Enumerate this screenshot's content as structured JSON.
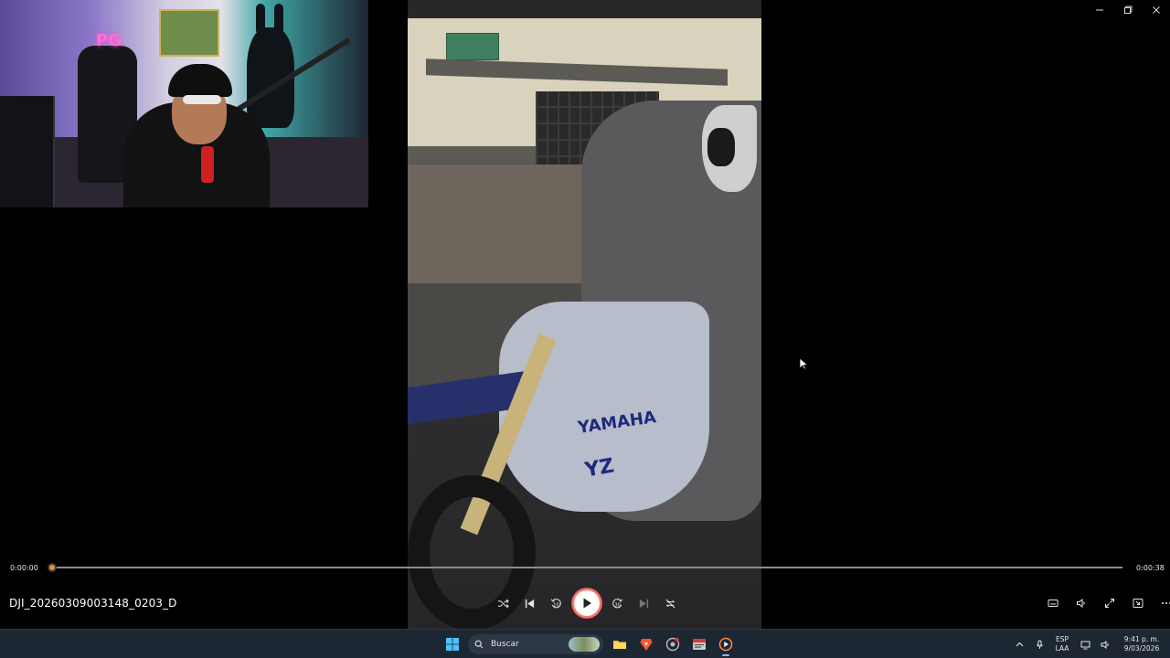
{
  "window": {
    "minimize_icon": "minimize-icon",
    "maximize_icon": "restore-icon",
    "close_icon": "close-icon"
  },
  "video": {
    "bike_brand_text": "YAMAHA",
    "bike_model_text": "YZ"
  },
  "webcam": {
    "neon_sign_text": "PG"
  },
  "player": {
    "current_time": "0:00:00",
    "total_time": "0:00:38",
    "progress": 0,
    "file_name": "DJI_20260309003148_0203_D",
    "colors": {
      "accent": "#e8912f",
      "play_ring": "#ff7a4f",
      "background": "#000000"
    },
    "controls": [
      {
        "name": "shuffle",
        "icon": "shuffle-icon"
      },
      {
        "name": "previous",
        "icon": "skip-previous-icon"
      },
      {
        "name": "rewind-10",
        "icon": "rewind-10-icon",
        "label": "10"
      },
      {
        "name": "play",
        "icon": "play-icon"
      },
      {
        "name": "forward-30",
        "icon": "forward-30-icon",
        "label": "30"
      },
      {
        "name": "next",
        "icon": "skip-next-icon"
      },
      {
        "name": "repeat-off",
        "icon": "repeat-off-icon"
      }
    ],
    "right_controls": [
      {
        "name": "subtitles",
        "icon": "subtitles-icon"
      },
      {
        "name": "volume",
        "icon": "volume-icon"
      },
      {
        "name": "fullscreen",
        "icon": "fullscreen-icon"
      },
      {
        "name": "miniplayer",
        "icon": "miniplayer-icon"
      },
      {
        "name": "more",
        "icon": "more-icon"
      }
    ]
  },
  "taskbar": {
    "search_label": "Buscar",
    "apps": [
      "windows-start-icon",
      "file-explorer-icon",
      "brave-browser-icon",
      "chrome-icon",
      "weather-app-icon",
      "media-player-icon"
    ],
    "lang_line1": "ESP",
    "lang_line2": "LAA",
    "time": "9:41 p. m.",
    "date": "9/03/2026",
    "tray_icons": [
      "chevron-up-icon",
      "microphone-icon",
      "network-icon",
      "speaker-icon"
    ]
  }
}
